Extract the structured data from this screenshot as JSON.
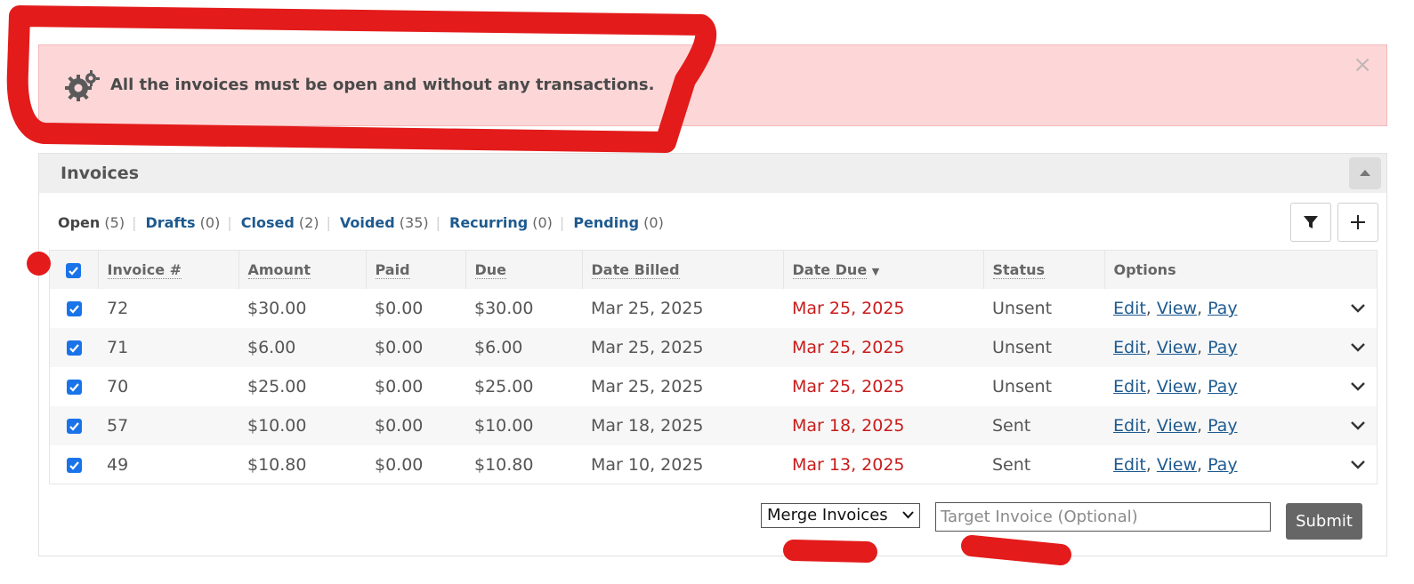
{
  "alert": {
    "icon": "gears-icon",
    "message": "All the invoices must be open and without any transactions.",
    "close_label": "×"
  },
  "panel": {
    "title": "Invoices",
    "collapse_icon": "caret-up-icon"
  },
  "filters": [
    {
      "label": "Open",
      "count": "(5)",
      "active": true
    },
    {
      "label": "Drafts",
      "count": "(0)",
      "active": false
    },
    {
      "label": "Closed",
      "count": "(2)",
      "active": false
    },
    {
      "label": "Voided",
      "count": "(35)",
      "active": false
    },
    {
      "label": "Recurring",
      "count": "(0)",
      "active": false
    },
    {
      "label": "Pending",
      "count": "(0)",
      "active": false
    }
  ],
  "toolbar": {
    "filter_icon": "filter-icon",
    "add_icon": "plus-icon"
  },
  "table": {
    "columns": [
      "Invoice #",
      "Amount",
      "Paid",
      "Due",
      "Date Billed",
      "Date Due",
      "Status",
      "Options"
    ],
    "sort_indicator": "▼",
    "rows": [
      {
        "invoice": "72",
        "amount": "$30.00",
        "paid": "$0.00",
        "due": "$30.00",
        "billed": "Mar 25, 2025",
        "date_due": "Mar 25, 2025",
        "status": "Unsent"
      },
      {
        "invoice": "71",
        "amount": "$6.00",
        "paid": "$0.00",
        "due": "$6.00",
        "billed": "Mar 25, 2025",
        "date_due": "Mar 25, 2025",
        "status": "Unsent"
      },
      {
        "invoice": "70",
        "amount": "$25.00",
        "paid": "$0.00",
        "due": "$25.00",
        "billed": "Mar 25, 2025",
        "date_due": "Mar 25, 2025",
        "status": "Unsent"
      },
      {
        "invoice": "57",
        "amount": "$10.00",
        "paid": "$0.00",
        "due": "$10.00",
        "billed": "Mar 18, 2025",
        "date_due": "Mar 18, 2025",
        "status": "Sent"
      },
      {
        "invoice": "49",
        "amount": "$10.80",
        "paid": "$0.00",
        "due": "$10.80",
        "billed": "Mar 10, 2025",
        "date_due": "Mar 13, 2025",
        "status": "Sent"
      }
    ],
    "row_actions": {
      "edit": "Edit",
      "view": "View",
      "pay": "Pay",
      "separator": ","
    }
  },
  "form": {
    "action_selected": "Merge Invoices",
    "target_placeholder": "Target Invoice (Optional)",
    "submit_label": "Submit"
  },
  "colors": {
    "alert_bg": "#fdd7d8",
    "link": "#1e5a8f",
    "overdue": "#c91b1b",
    "checkbox": "#1a73e8",
    "annotation": "#e31b1b"
  }
}
